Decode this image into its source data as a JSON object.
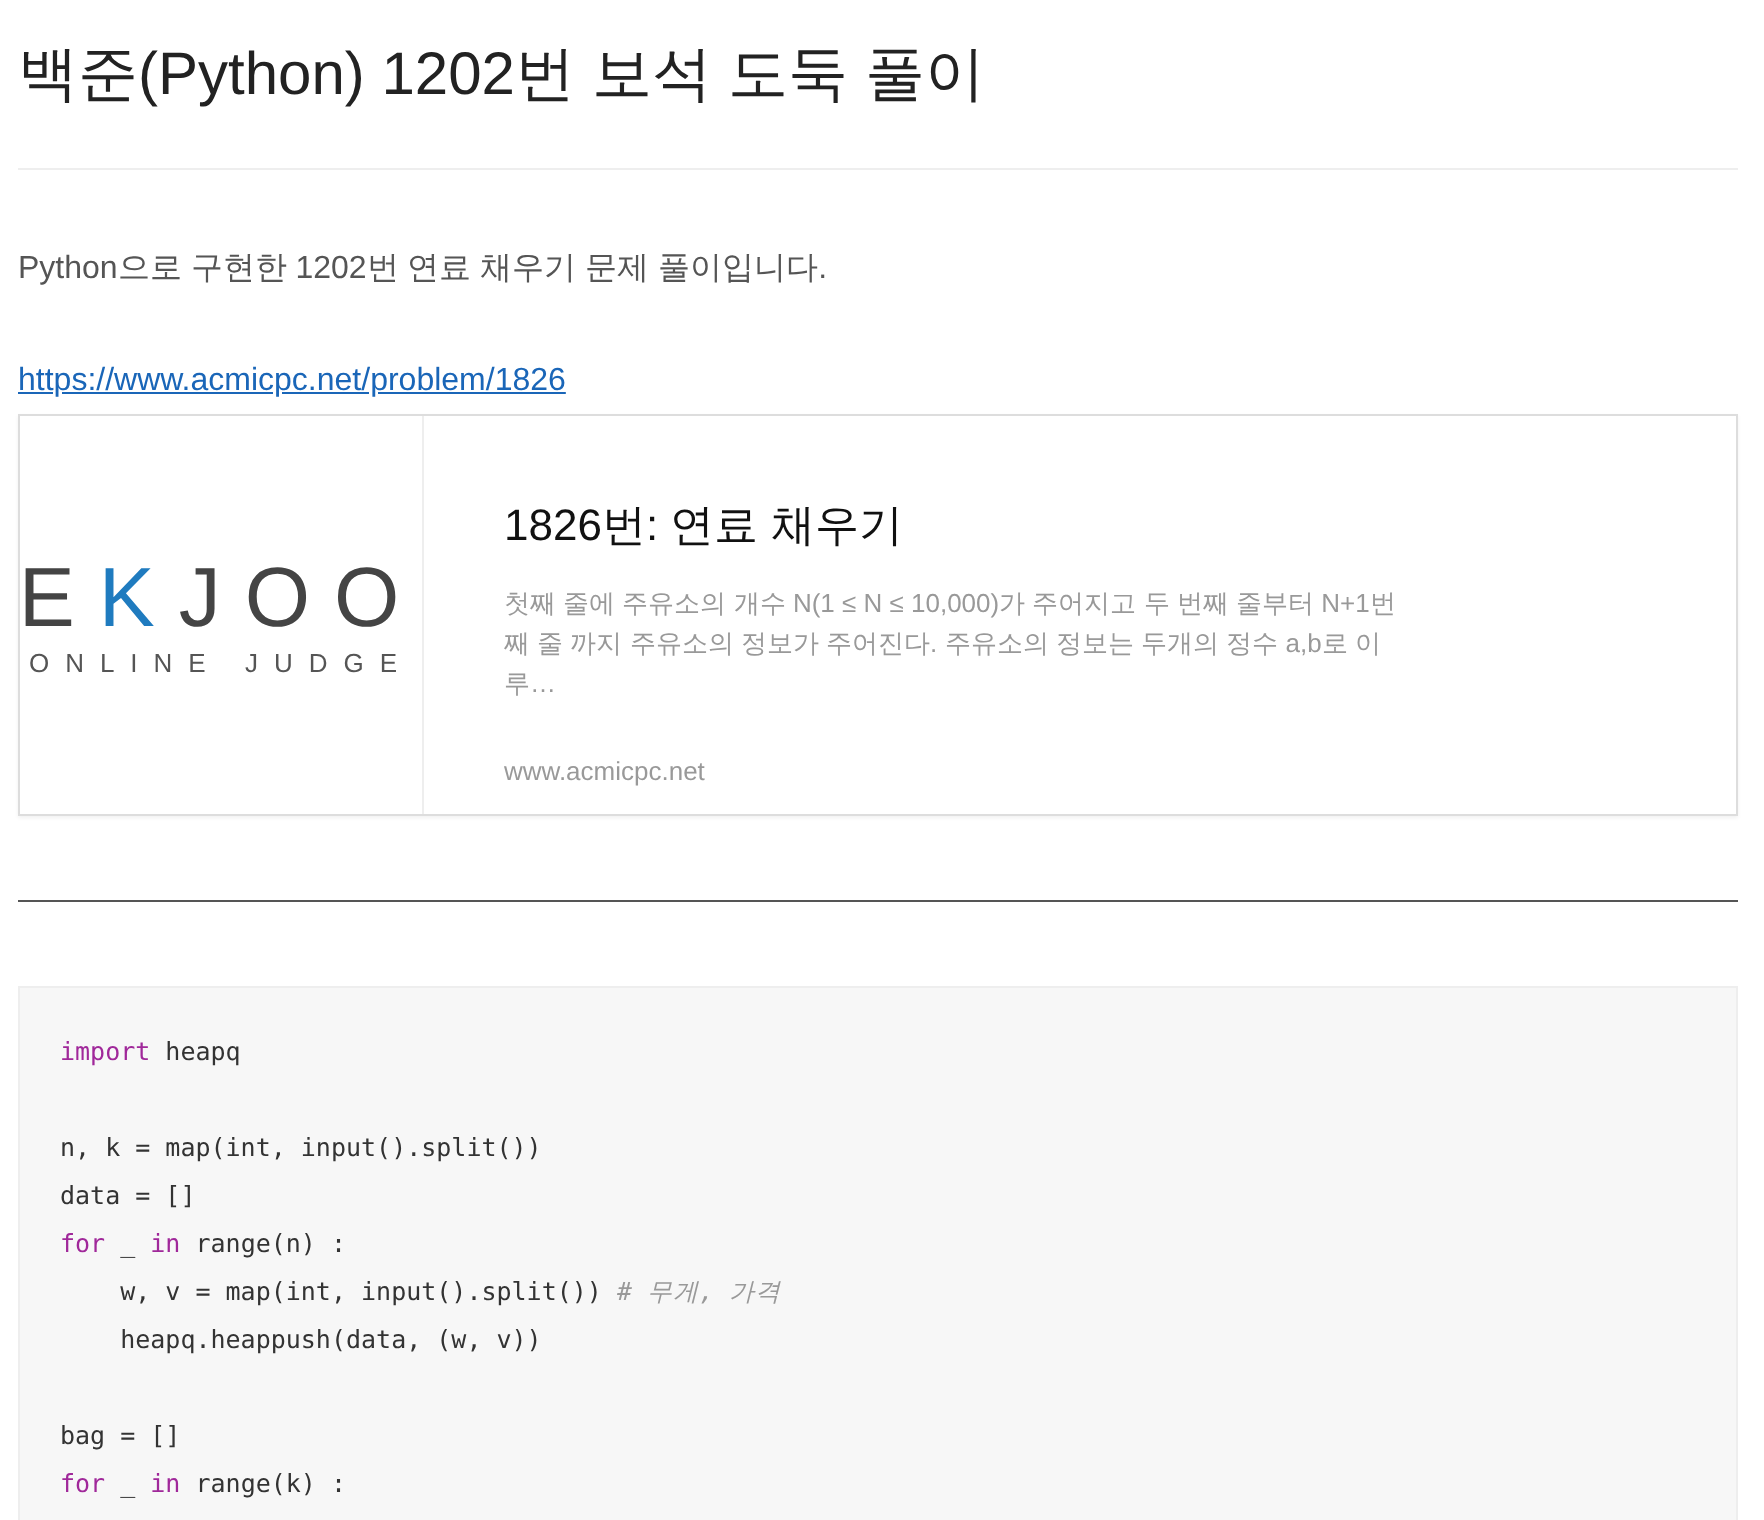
{
  "title": "백준(Python) 1202번 보석 도둑 풀이",
  "intro": "Python으로 구현한 1202번 연료 채우기 문제 풀이입니다.",
  "link": "https://www.acmicpc.net/problem/1826",
  "link_card": {
    "logo": {
      "letters": [
        {
          "text": "E",
          "accent": false
        },
        {
          "text": "K",
          "accent": true
        },
        {
          "text": "JOO",
          "accent": false
        }
      ],
      "subtitle": "ONLINE JUDGE"
    },
    "title": "1826번: 연료 채우기",
    "description": "첫째 줄에 주유소의 개수 N(1 ≤ N ≤ 10,000)가 주어지고 두 번째 줄부터 N+1번째 줄 까지 주유소의 정보가 주어진다. 주유소의 정보는 두개의 정수 a,b로 이루…",
    "domain": "www.acmicpc.net"
  },
  "code": [
    [
      {
        "text": "import",
        "kind": "keyword"
      },
      {
        "text": " heapq",
        "kind": "plain"
      }
    ],
    [
      {
        "kind": "blank"
      }
    ],
    [
      {
        "text": "n, k = map(int, input().split())",
        "kind": "plain"
      }
    ],
    [
      {
        "text": "data = []",
        "kind": "plain"
      }
    ],
    [
      {
        "text": "for",
        "kind": "keyword"
      },
      {
        "text": " _ ",
        "kind": "plain"
      },
      {
        "text": "in",
        "kind": "keyword"
      },
      {
        "text": " range(n) :",
        "kind": "plain"
      }
    ],
    [
      {
        "text": "    w, v = map(int, input().split()) ",
        "kind": "plain"
      },
      {
        "text": "# 무게, 가격",
        "kind": "comment"
      }
    ],
    [
      {
        "text": "    heapq.heappush(data, (w, v))",
        "kind": "plain"
      }
    ],
    [
      {
        "kind": "blank"
      }
    ],
    [
      {
        "text": "bag = []",
        "kind": "plain"
      }
    ],
    [
      {
        "text": "for",
        "kind": "keyword"
      },
      {
        "text": " _ ",
        "kind": "plain"
      },
      {
        "text": "in",
        "kind": "keyword"
      },
      {
        "text": " range(k) :",
        "kind": "plain"
      }
    ]
  ]
}
